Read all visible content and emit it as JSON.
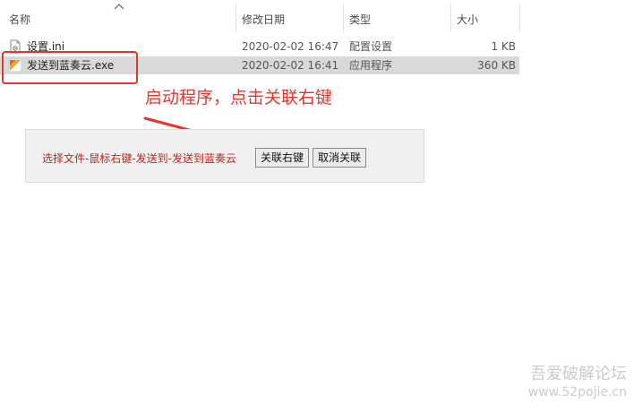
{
  "columns": {
    "name": "名称",
    "modified": "修改日期",
    "type": "类型",
    "size": "大小"
  },
  "files": [
    {
      "name": "设置.ini",
      "modified": "2020-02-02 16:47",
      "type": "配置设置",
      "size": "1 KB",
      "icon": "ini-file-icon"
    },
    {
      "name": "发送到蓝奏云.exe",
      "modified": "2020-02-02 16:41",
      "type": "应用程序",
      "size": "360 KB",
      "icon": "exe-file-icon",
      "selected": true
    }
  ],
  "annotation": {
    "text": "启动程序，点击关联右键",
    "color": "#e8352b"
  },
  "dialog": {
    "label": "选择文件-鼠标右键-发送到-发送到蓝奏云",
    "associate_button": "关联右键",
    "cancel_button": "取消关联"
  },
  "watermark": {
    "title": "吾爱破解论坛",
    "url": "www.52pojie.cn"
  }
}
